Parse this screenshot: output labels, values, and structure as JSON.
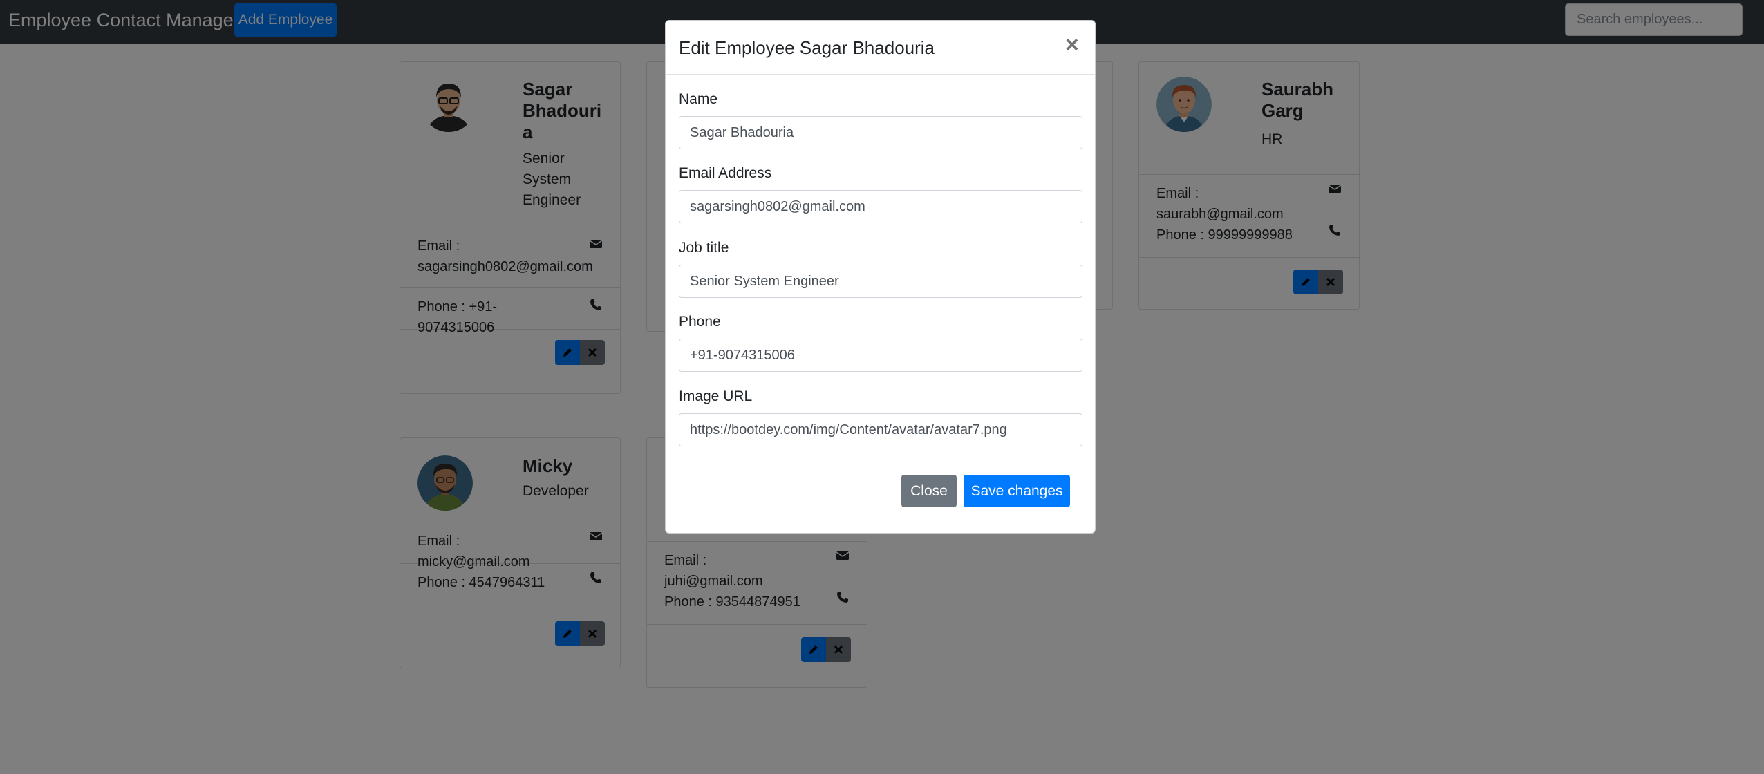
{
  "navbar": {
    "brand": "Employee Contact Manager",
    "add_button": "Add Employee",
    "search_placeholder": "Search employees..."
  },
  "employees": [
    {
      "name_lines": [
        "Sagar",
        "Bhadouri",
        "a"
      ],
      "job_lines": [
        "Senior",
        "System",
        "Engineer"
      ],
      "email_lines": [
        "Email :",
        "sagarsingh0802@gmail.com"
      ],
      "phone": "Phone : +91-9074315006",
      "avatar_icon": "avatar-glasses-man"
    },
    {
      "name_lines": [
        "Saurabh",
        "Garg"
      ],
      "job_lines": [
        "HR"
      ],
      "email_lines": [
        "Email : saurabh@gmail.com"
      ],
      "phone": "Phone : 99999999988",
      "avatar_icon": "avatar-red-hair-man"
    },
    {
      "name_lines": [
        "Micky"
      ],
      "job_lines": [
        "Developer"
      ],
      "email_lines": [
        "Email : micky@gmail.com"
      ],
      "phone": "Phone : 4547964311",
      "avatar_icon": "avatar-bearded-man"
    },
    {
      "email_lines": [
        "Email : juhi@gmail.com"
      ],
      "phone": "Phone : 93544874951"
    }
  ],
  "modal": {
    "title": "Edit Employee Sagar Bhadouria",
    "close_symbol": "×",
    "fields": [
      {
        "label": "Name",
        "value": "Sagar Bhadouria"
      },
      {
        "label": "Email Address",
        "value": "sagarsingh0802@gmail.com"
      },
      {
        "label": "Job title",
        "value": "Senior System Engineer"
      },
      {
        "label": "Phone",
        "value": "+91-9074315006"
      },
      {
        "label": "Image URL",
        "value": "https://bootdey.com/img/Content/avatar/avatar7.png"
      }
    ],
    "close_button": "Close",
    "save_button": "Save changes"
  },
  "icons": {
    "email": "envelope-icon",
    "phone": "phone-icon",
    "edit": "pencil-icon",
    "delete": "times-icon"
  },
  "colors": {
    "primary": "#007bff",
    "secondary": "#6c757d",
    "navbar": "#343a40"
  }
}
